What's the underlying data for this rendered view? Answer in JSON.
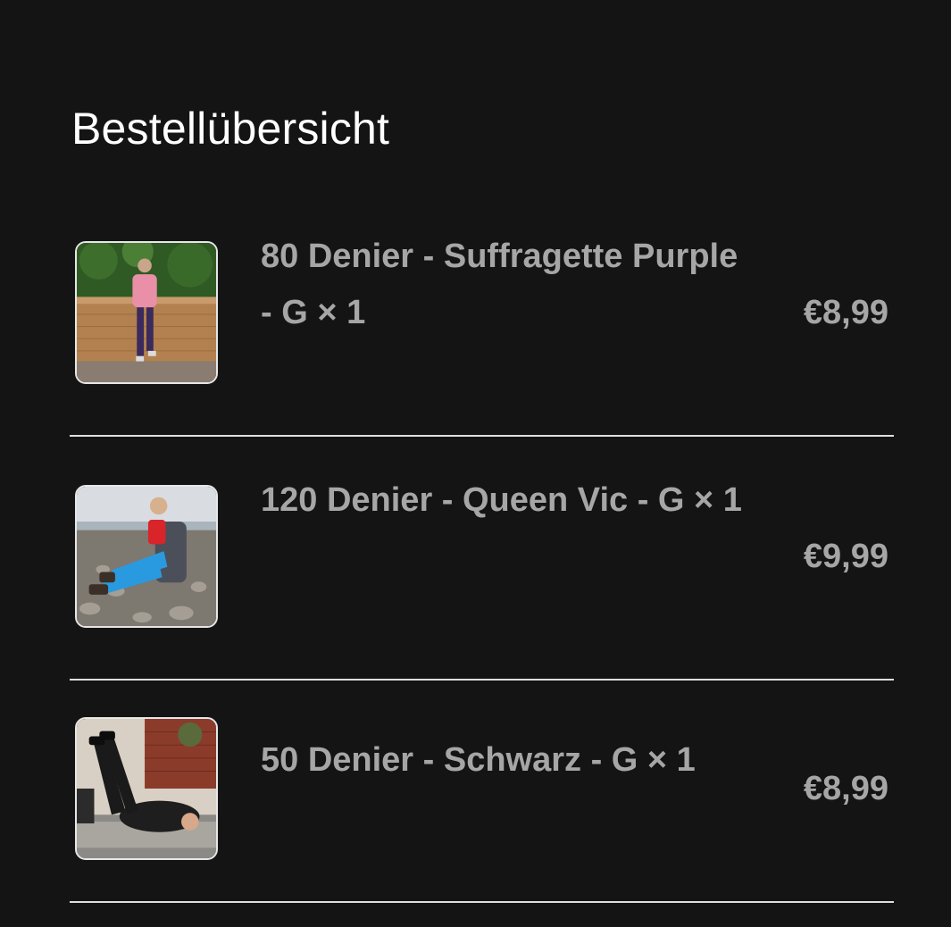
{
  "page": {
    "title": "Bestellübersicht"
  },
  "items": [
    {
      "name": "80 Denier - Suffragette Purple - G × 1",
      "price": "€8,99"
    },
    {
      "name": "120 Denier - Queen Vic - G × 1",
      "price": "€9,99"
    },
    {
      "name": "50 Denier - Schwarz - G × 1",
      "price": "€8,99"
    }
  ]
}
